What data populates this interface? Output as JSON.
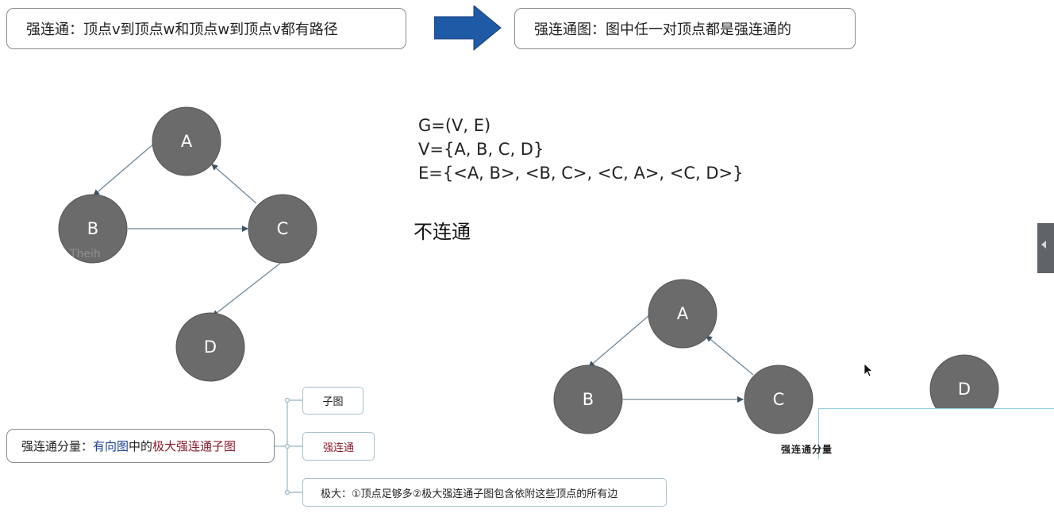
{
  "definitions": {
    "strongly_connected": "强连通：顶点v到顶点w和顶点w到顶点v都有路径",
    "strongly_connected_graph": "强连通图：图中任一对顶点都是强连通的"
  },
  "graph1": {
    "nodes": [
      "A",
      "B",
      "C",
      "D"
    ],
    "edges": [
      [
        "A",
        "B"
      ],
      [
        "B",
        "C"
      ],
      [
        "C",
        "A"
      ],
      [
        "C",
        "D"
      ]
    ],
    "watermark": "Theih"
  },
  "formulas": {
    "g": "G=(V, E)",
    "v": "V={A, B, C, D}",
    "e": "E={<A, B>, <B, C>, <C, A>,  <C, D>}"
  },
  "verdict": "不连通",
  "graph2": {
    "nodes": [
      "A",
      "B",
      "C",
      "D"
    ],
    "edges": [
      [
        "A",
        "B"
      ],
      [
        "B",
        "C"
      ],
      [
        "C",
        "A"
      ]
    ]
  },
  "caption": "强连通分量",
  "mindmap": {
    "root_prefix": "强连通分量：",
    "root_part1": "有向图",
    "root_part2": "中的",
    "root_part3": "极大强连通子图",
    "children": [
      "子图",
      "强连通",
      "极大：①顶点足够多②极大强连通子图包含依附这些顶点的所有边"
    ]
  },
  "colors": {
    "node_fill": "#6b6b6b",
    "edge": "#6f8799",
    "arrow_blue": "#1f5aa6",
    "highlight_blue": "#1f3f8f",
    "highlight_red": "#8b1c2c"
  }
}
